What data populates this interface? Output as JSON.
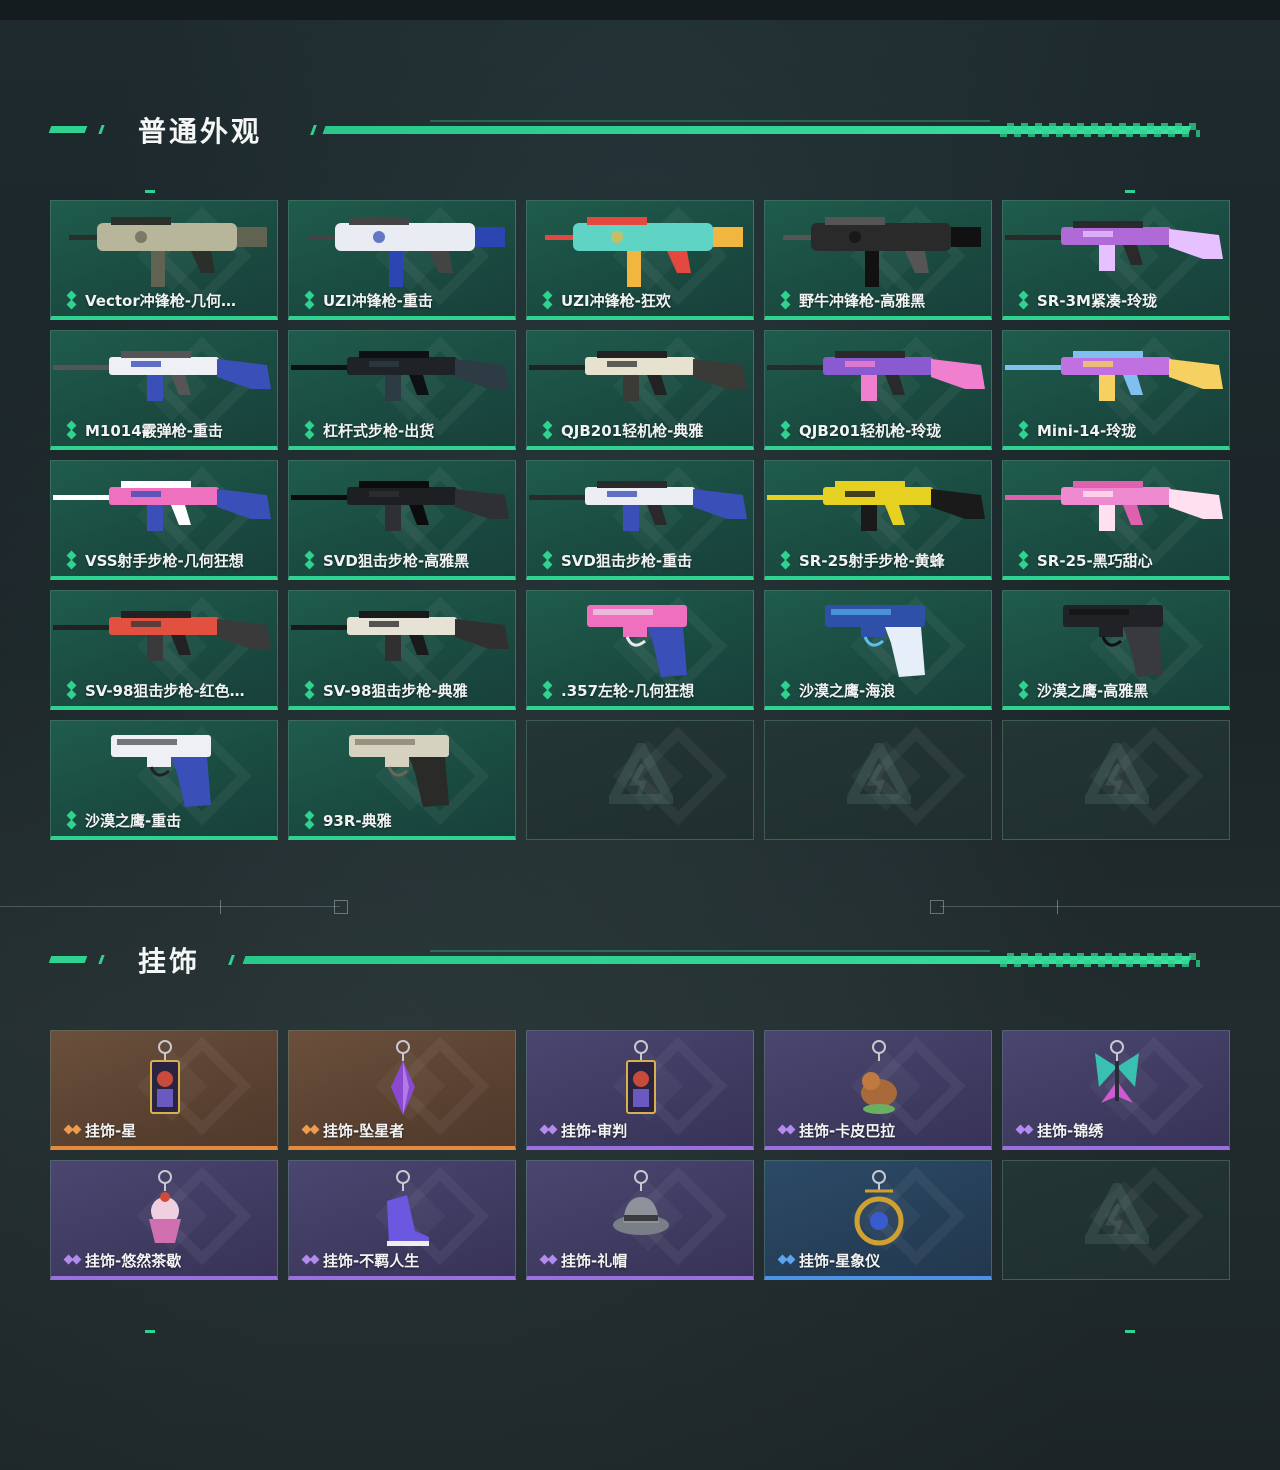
{
  "sections": {
    "skins": {
      "title": "普通外观"
    },
    "charms": {
      "title": "挂饰"
    }
  },
  "skins": [
    {
      "label": "Vector冲锋枪-几何…",
      "rarity": "green",
      "art": "smg-camo"
    },
    {
      "label": "UZI冲锋枪-重击",
      "rarity": "green",
      "art": "uzi-white"
    },
    {
      "label": "UZI冲锋枪-狂欢",
      "rarity": "green",
      "art": "uzi-colorful"
    },
    {
      "label": "野牛冲锋枪-高雅黑",
      "rarity": "green",
      "art": "smg-black"
    },
    {
      "label": "SR-3M紧凑-玲珑",
      "rarity": "green",
      "art": "rifle-purple"
    },
    {
      "label": "M1014霰弹枪-重击",
      "rarity": "green",
      "art": "shotgun-white"
    },
    {
      "label": "杠杆式步枪-出货",
      "rarity": "green",
      "art": "lever-black"
    },
    {
      "label": "QJB201轻机枪-典雅",
      "rarity": "green",
      "art": "lmg-cream"
    },
    {
      "label": "QJB201轻机枪-玲珑",
      "rarity": "green",
      "art": "lmg-purple"
    },
    {
      "label": "Mini-14-玲珑",
      "rarity": "green",
      "art": "rifle-pastel"
    },
    {
      "label": "VSS射手步枪-几何狂想",
      "rarity": "green",
      "art": "vss-pink"
    },
    {
      "label": "SVD狙击步枪-高雅黑",
      "rarity": "green",
      "art": "svd-black"
    },
    {
      "label": "SVD狙击步枪-重击",
      "rarity": "green",
      "art": "svd-white"
    },
    {
      "label": "SR-25射手步枪-黄蜂",
      "rarity": "green",
      "art": "sr25-yellow"
    },
    {
      "label": "SR-25-黑巧甜心",
      "rarity": "green",
      "art": "sr25-pink"
    },
    {
      "label": "SV-98狙击步枪-红色…",
      "rarity": "green",
      "art": "sv98-red"
    },
    {
      "label": "SV-98狙击步枪-典雅",
      "rarity": "green",
      "art": "sv98-cream"
    },
    {
      "label": ".357左轮-几何狂想",
      "rarity": "green",
      "art": "revolver-pink"
    },
    {
      "label": "沙漠之鹰-海浪",
      "rarity": "green",
      "art": "deagle-blue"
    },
    {
      "label": "沙漠之鹰-高雅黑",
      "rarity": "green",
      "art": "deagle-black"
    },
    {
      "label": "沙漠之鹰-重击",
      "rarity": "green",
      "art": "deagle-white"
    },
    {
      "label": "93R-典雅",
      "rarity": "green",
      "art": "pistol-cream"
    },
    {
      "label": "",
      "rarity": "empty",
      "art": "logo-icon"
    },
    {
      "label": "",
      "rarity": "empty",
      "art": "logo-icon"
    },
    {
      "label": "",
      "rarity": "empty",
      "art": "logo-icon"
    }
  ],
  "charms": [
    {
      "label": "挂饰-星",
      "rarity": "orange",
      "art": "charm-card-icon"
    },
    {
      "label": "挂饰-坠星者",
      "rarity": "orange",
      "art": "charm-crystal-icon"
    },
    {
      "label": "挂饰-审判",
      "rarity": "purple",
      "art": "charm-card-icon"
    },
    {
      "label": "挂饰-卡皮巴拉",
      "rarity": "purple",
      "art": "charm-capybara-icon"
    },
    {
      "label": "挂饰-锦绣",
      "rarity": "purple",
      "art": "charm-butterfly-icon"
    },
    {
      "label": "挂饰-悠然茶歇",
      "rarity": "purple",
      "art": "charm-cupcake-icon"
    },
    {
      "label": "挂饰-不羁人生",
      "rarity": "purple",
      "art": "charm-shoe-icon"
    },
    {
      "label": "挂饰-礼帽",
      "rarity": "purple",
      "art": "charm-hat-icon"
    },
    {
      "label": "挂饰-星象仪",
      "rarity": "blue",
      "art": "charm-astrolabe-icon"
    },
    {
      "label": "",
      "rarity": "empty",
      "art": "logo-icon"
    }
  ],
  "colors": {
    "accent": "#2fd38f",
    "orange": "#e48a3c",
    "purple": "#9a6fe0",
    "blue": "#4c93e6"
  }
}
